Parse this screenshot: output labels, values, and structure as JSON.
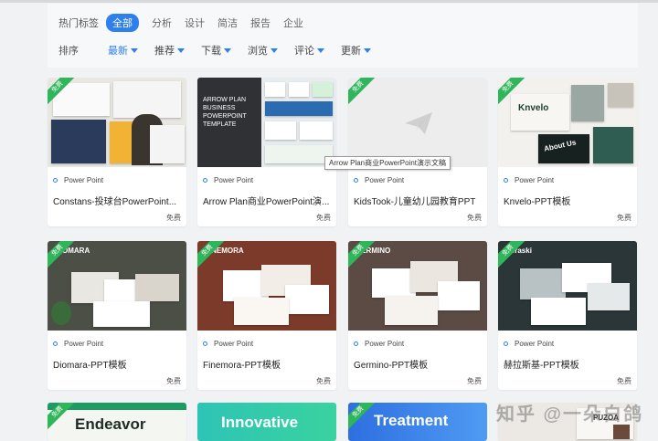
{
  "filters": {
    "hot_label": "热门标签",
    "tags": [
      "全部",
      "分析",
      "设计",
      "简洁",
      "报告",
      "企业"
    ],
    "active_tag": "全部",
    "sort_label": "排序",
    "sort_options": [
      "最新",
      "推荐",
      "下载",
      "浏览",
      "评论",
      "更新"
    ],
    "active_sort": "最新"
  },
  "cards": [
    {
      "ribbon": "免费",
      "category": "Power Point",
      "title": "Constans-投球台PowerPoint...",
      "price": "免费"
    },
    {
      "ribbon": "",
      "category": "Power Point",
      "title": "Arrow Plan商业PowerPoint演...",
      "price": "免费",
      "thumb_text": "ARROW PLAN BUSINESS POWERPOINT TEMPLATE"
    },
    {
      "ribbon": "免费",
      "category": "Power Point",
      "title": "KidsTook-儿童幼儿园教育PPT",
      "price": "免费"
    },
    {
      "ribbon": "免费",
      "category": "Power Point",
      "title": "Knvelo-PPT模板",
      "price": "免费",
      "thumb_text": "Knvelo",
      "thumb_text2": "About Us"
    },
    {
      "ribbon": "免费",
      "category": "Power Point",
      "title": "Diomara-PPT模板",
      "price": "免费",
      "thumb_text": "DIOMARA"
    },
    {
      "ribbon": "免费",
      "category": "Power Point",
      "title": "Finemora-PPT模板",
      "price": "免费",
      "thumb_text": "FINEMORA"
    },
    {
      "ribbon": "免费",
      "category": "Power Point",
      "title": "Germino-PPT模板",
      "price": "免费",
      "thumb_text": "GERMINO"
    },
    {
      "ribbon": "免费",
      "category": "Power Point",
      "title": "赫拉斯基-PPT模板",
      "price": "免费",
      "thumb_text": "Heraski"
    }
  ],
  "partial_cards": [
    {
      "ribbon": "免费",
      "thumb_text": "Endeavor"
    },
    {
      "ribbon": "",
      "thumb_text": "Innovative"
    },
    {
      "ribbon": "免费",
      "thumb_text": "Treatment"
    },
    {
      "ribbon": "",
      "thumb_text": "PUZOA"
    }
  ],
  "tooltip": "Arrow Plan商业PowerPoint演示文稿",
  "watermark": "知乎 @一朵白鸽",
  "colors": {
    "accent": "#2f80ed",
    "ribbon": "#2fb55a"
  }
}
